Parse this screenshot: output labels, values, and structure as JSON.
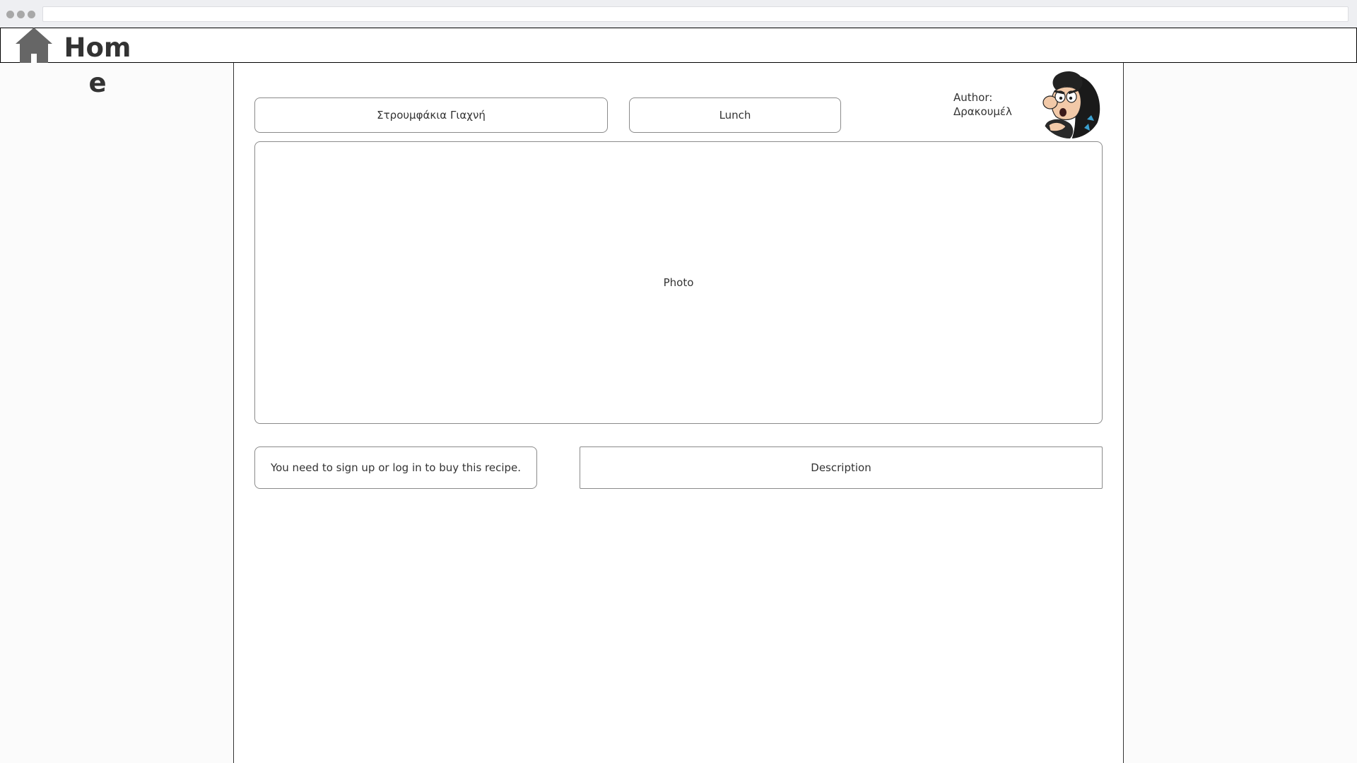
{
  "header": {
    "title": "Home",
    "icon": "home-icon"
  },
  "recipe": {
    "name": "Στρουμφάκια Γιαχνή",
    "category": "Lunch",
    "author_label": "Author: Δρακουμέλ",
    "avatar_icon": "author-avatar",
    "photo_label": "Photo",
    "purchase_notice": "You need to sign up or log in to buy this recipe.",
    "description_label": "Description"
  }
}
